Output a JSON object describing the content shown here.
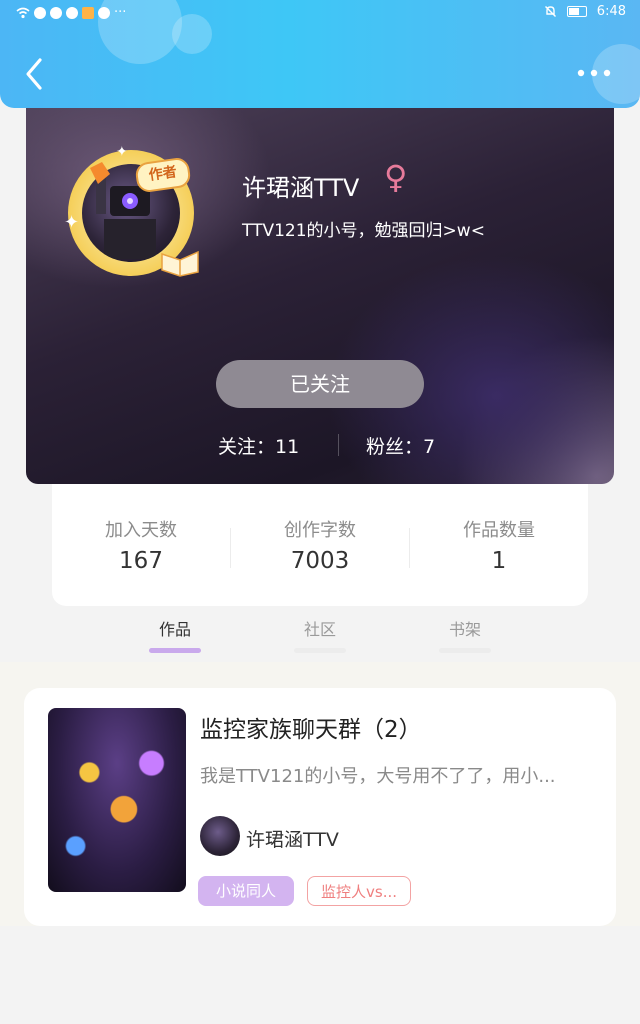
{
  "status_bar": {
    "time": "6:48",
    "more_indicator": "···"
  },
  "header": {
    "back_icon": "chevron-left-icon",
    "more_icon": "more-dots-icon",
    "more_label": "···"
  },
  "profile": {
    "username": "许珺涵TTV",
    "gender_symbol": "♀",
    "bio": "TTV121的小号，勉强回归>w<",
    "author_badge": "作者",
    "follow_button_label": "已关注",
    "following_label": "关注：11",
    "followers_label": "粉丝：7"
  },
  "stats": [
    {
      "label": "加入天数",
      "value": "167"
    },
    {
      "label": "创作字数",
      "value": "7003"
    },
    {
      "label": "作品数量",
      "value": "1"
    }
  ],
  "tabs": [
    {
      "label": "作品",
      "active": true
    },
    {
      "label": "社区",
      "active": false
    },
    {
      "label": "书架",
      "active": false
    }
  ],
  "works": [
    {
      "title": "监控家族聊天群（2）",
      "description": "我是TTV121的小号，大号用不了了，用小...",
      "author": "许珺涵TTV",
      "tags": [
        "小说同人",
        "监控人vs..."
      ]
    }
  ],
  "colors": {
    "header_blue": "#3ec7f6",
    "tab_indicator": "#c9a9ec",
    "tag_purple": "#d3b4f0",
    "tag_outline": "#ef7f7f",
    "gender_pink": "#e77b9b"
  }
}
